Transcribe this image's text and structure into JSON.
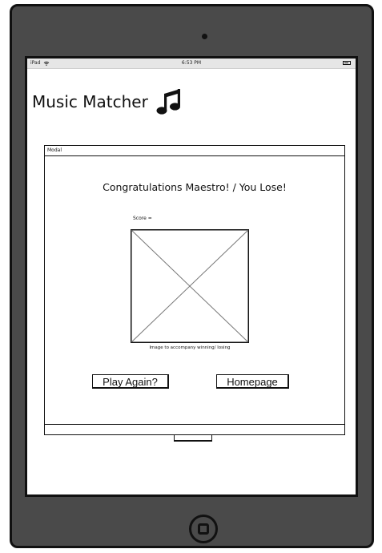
{
  "status_bar": {
    "device": "iPad",
    "time": "6:53 PM",
    "wifi_icon": "wifi-icon",
    "battery_icon": "battery-icon"
  },
  "app": {
    "title": "Music Matcher",
    "title_icon": "music-notes-icon"
  },
  "modal": {
    "header_label": "Modal",
    "heading": "Congratulations Maestro! / You Lose!",
    "score_label": "Score =",
    "image_icon": "image-placeholder-icon",
    "image_caption": "Image to accompany winning/ losing",
    "play_again_label": "Play Again?",
    "homepage_label": "Homepage"
  }
}
